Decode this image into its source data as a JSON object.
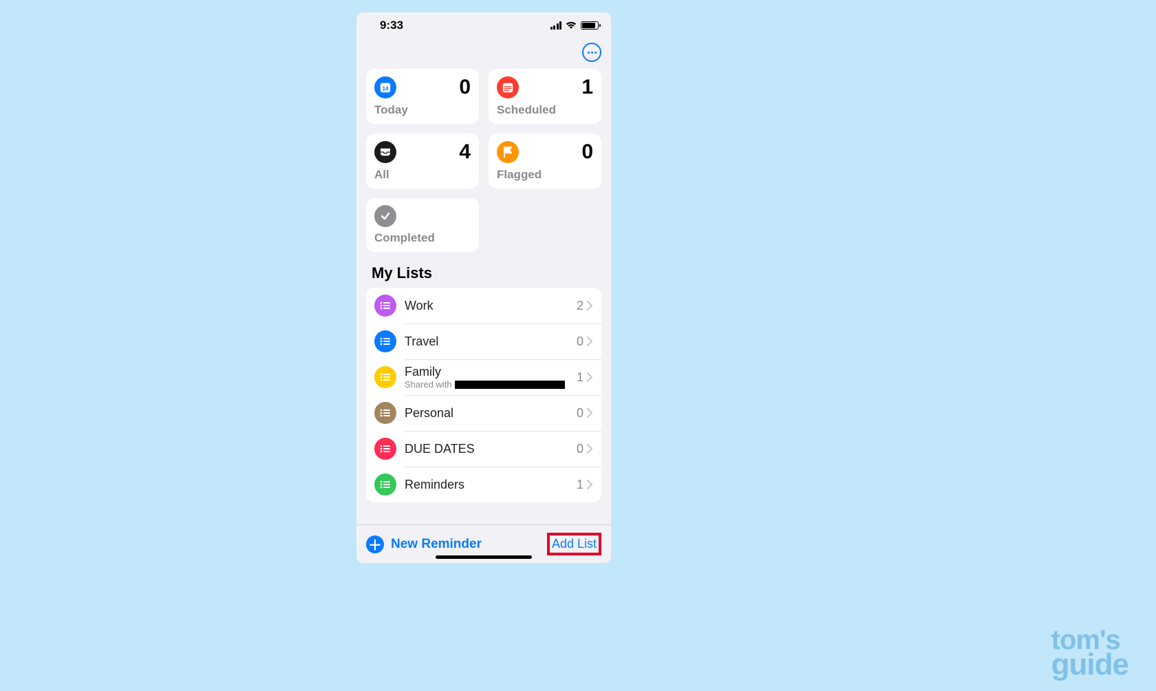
{
  "status": {
    "time": "9:33"
  },
  "smart": {
    "today": {
      "label": "Today",
      "count": "0",
      "color": "#0a7aff"
    },
    "scheduled": {
      "label": "Scheduled",
      "count": "1",
      "color": "#ff3b30"
    },
    "all": {
      "label": "All",
      "count": "4",
      "color": "#1c1c1e"
    },
    "flagged": {
      "label": "Flagged",
      "count": "0",
      "color": "#ff9500"
    },
    "completed": {
      "label": "Completed",
      "color": "#8e8e93"
    }
  },
  "section": {
    "my_lists": "My Lists"
  },
  "lists": [
    {
      "name": "Work",
      "count": "2",
      "color": "#bf5af2"
    },
    {
      "name": "Travel",
      "count": "0",
      "color": "#0a7aff"
    },
    {
      "name": "Family",
      "count": "1",
      "color": "#ffcc00",
      "shared_prefix": "Shared with"
    },
    {
      "name": "Personal",
      "count": "0",
      "color": "#a2845e"
    },
    {
      "name": "DUE DATES",
      "count": "0",
      "color": "#ff2d55"
    },
    {
      "name": "Reminders",
      "count": "1",
      "color": "#34c759"
    }
  ],
  "bottom": {
    "new_reminder": "New Reminder",
    "add_list": "Add List"
  },
  "watermark": {
    "line1": "tom's",
    "line2": "guide"
  }
}
